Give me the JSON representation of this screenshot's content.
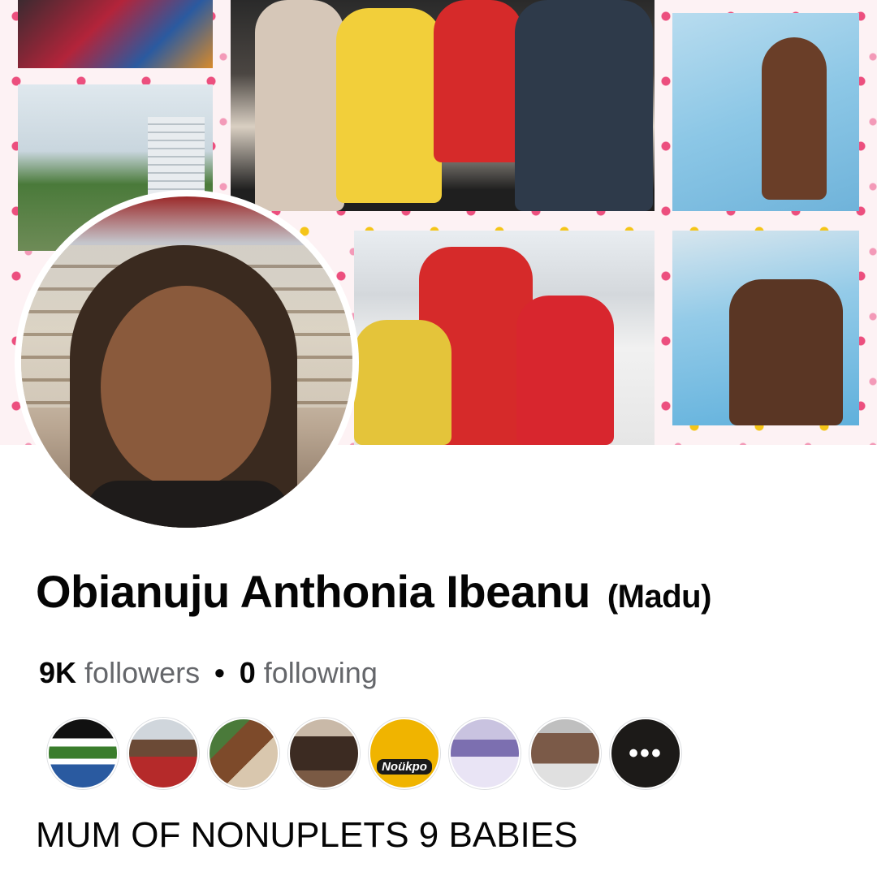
{
  "profile": {
    "name": "Obianuju Anthonia Ibeanu",
    "alternate_name": "(Madu)",
    "followers_count": "9K",
    "followers_label": "followers",
    "separator": "•",
    "following_count": "0",
    "following_label": "following",
    "bio": "MUM OF NONUPLETS 9 BABIES"
  },
  "friends": {
    "more_glyph": "•••",
    "items": [
      {
        "label": "friend-avatar-1",
        "color": "#3a7d2c"
      },
      {
        "label": "friend-avatar-2",
        "color": "#b52a2a"
      },
      {
        "label": "friend-avatar-3",
        "color": "#7d4a2a"
      },
      {
        "label": "friend-avatar-4",
        "color": "#3c2b22"
      },
      {
        "label": "friend-avatar-5",
        "color": "#f0b400"
      },
      {
        "label": "friend-avatar-6",
        "color": "#7c6fb0"
      },
      {
        "label": "friend-avatar-7",
        "color": "#8f8f8f"
      }
    ],
    "logo_text": "Noükpo"
  },
  "colors": {
    "accent_pink": "#ec4f7e",
    "accent_yellow": "#f5c518",
    "text_primary": "#050505",
    "text_secondary": "#65676b"
  }
}
